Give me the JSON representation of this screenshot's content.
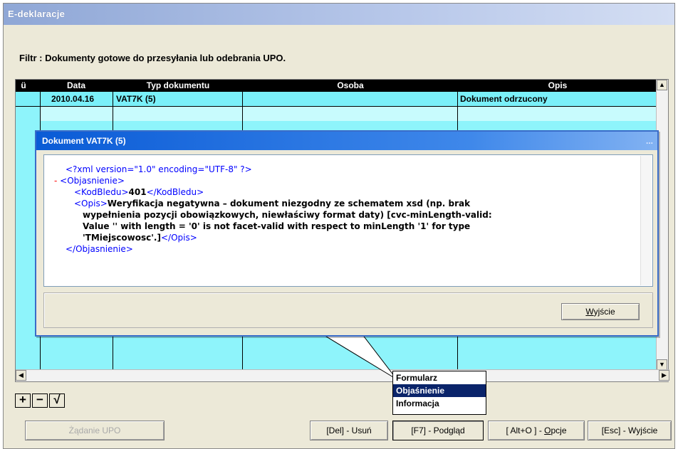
{
  "window": {
    "title": "E-deklaracje"
  },
  "filter": {
    "text": "Filtr : Dokumenty gotowe do przesyłania lub odebrania UPO."
  },
  "table": {
    "columns": [
      "ü",
      "Data",
      "Typ dokumentu",
      "Osoba",
      "Opis"
    ],
    "rows": [
      {
        "data": "2010.04.16",
        "typ": "VAT7K (5)",
        "osoba": "",
        "opis": "Dokument odrzucony"
      }
    ]
  },
  "toolbar": {
    "add": "+",
    "remove": "−",
    "check": "√"
  },
  "context_menu": {
    "items": [
      "Formularz",
      "Objaśnienie",
      "Informacja"
    ],
    "selected": "Objaśnienie"
  },
  "dialog": {
    "title": "Dokument VAT7K (5)",
    "dots": "...",
    "xml": {
      "decl": "<?xml version=\"1.0\" encoding=\"UTF-8\" ?>",
      "minus": "-",
      "open_root": "<Objasnienie>",
      "kod_open": "<KodBledu>",
      "kod_value": "401",
      "kod_close": "</KodBledu>",
      "opis_open": "<Opis>",
      "opis_line1": "Weryfikacja negatywna – dokument niezgodny ze schematem xsd (np. brak",
      "opis_line2": "wypełnienia pozycji obowiązkowych, niewłaściwy format daty) [cvc-minLength-valid:",
      "opis_line3": "Value '' with length = '0' is not facet-valid with respect to minLength '1' for type",
      "opis_line4": "'TMiejscowosc'.]",
      "opis_close": "</Opis>",
      "close_root": "</Objasnienie>"
    },
    "exit_button": {
      "prefix": "",
      "accel": "W",
      "rest": "yjście"
    }
  },
  "buttons": {
    "upo": "Żądanie UPO",
    "delete": "[Del] - Usuń",
    "preview": "[F7] - Podgląd",
    "options_prefix": "[ Alt+O ] - ",
    "options_accel": "O",
    "options_rest": "pcje",
    "exit": "[Esc] - Wyjście"
  }
}
